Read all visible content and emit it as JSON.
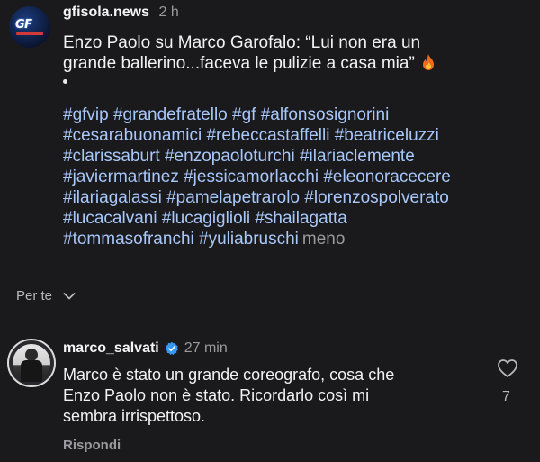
{
  "post": {
    "username": "gfisola.news",
    "time": "2 h",
    "avatar_logo": "GF ISOLA",
    "caption_line1": "Enzo Paolo su Marco Garofalo: “Lui non era un",
    "caption_line2": "grande ballerino...faceva le pulizie a casa mia”",
    "caption_icon": "fire-emoji",
    "hashtag_lines": [
      "#gfvip #grandefratello #gf #alfonsosignorini",
      "#cesarabuonamici #rebeccastaffelli #beatriceluzzi",
      "#clarissaburt #enzopaoloturchi #ilariaclemente",
      "#javiermartinez #jessicamorlacchi #eleonoracecere",
      "#ilariagalassi #pamelapetrarolo #lorenzospolverato",
      "#lucacalvani #lucagiglioli #shailagatta",
      "#tommasofranchi #yuliabruschi"
    ],
    "more_label": "meno"
  },
  "section": {
    "label": "Per te",
    "icon": "chevron-down-icon"
  },
  "comment": {
    "username": "marco_salvati",
    "verified_icon": "verified-badge-icon",
    "time": "27 min",
    "text_lines": [
      "Marco è stato un grande coreografo, cosa che",
      "Enzo Paolo non è stato. Ricordarlo così mi",
      "sembra irrispettoso."
    ],
    "reply_label": "Rispondi",
    "like_icon": "heart-outline-icon",
    "like_count": "7"
  },
  "colors": {
    "background": "#1a1a1d",
    "hashtag": "#a8c7fa",
    "muted": "#9a9a9e",
    "verified": "#3897f0"
  }
}
